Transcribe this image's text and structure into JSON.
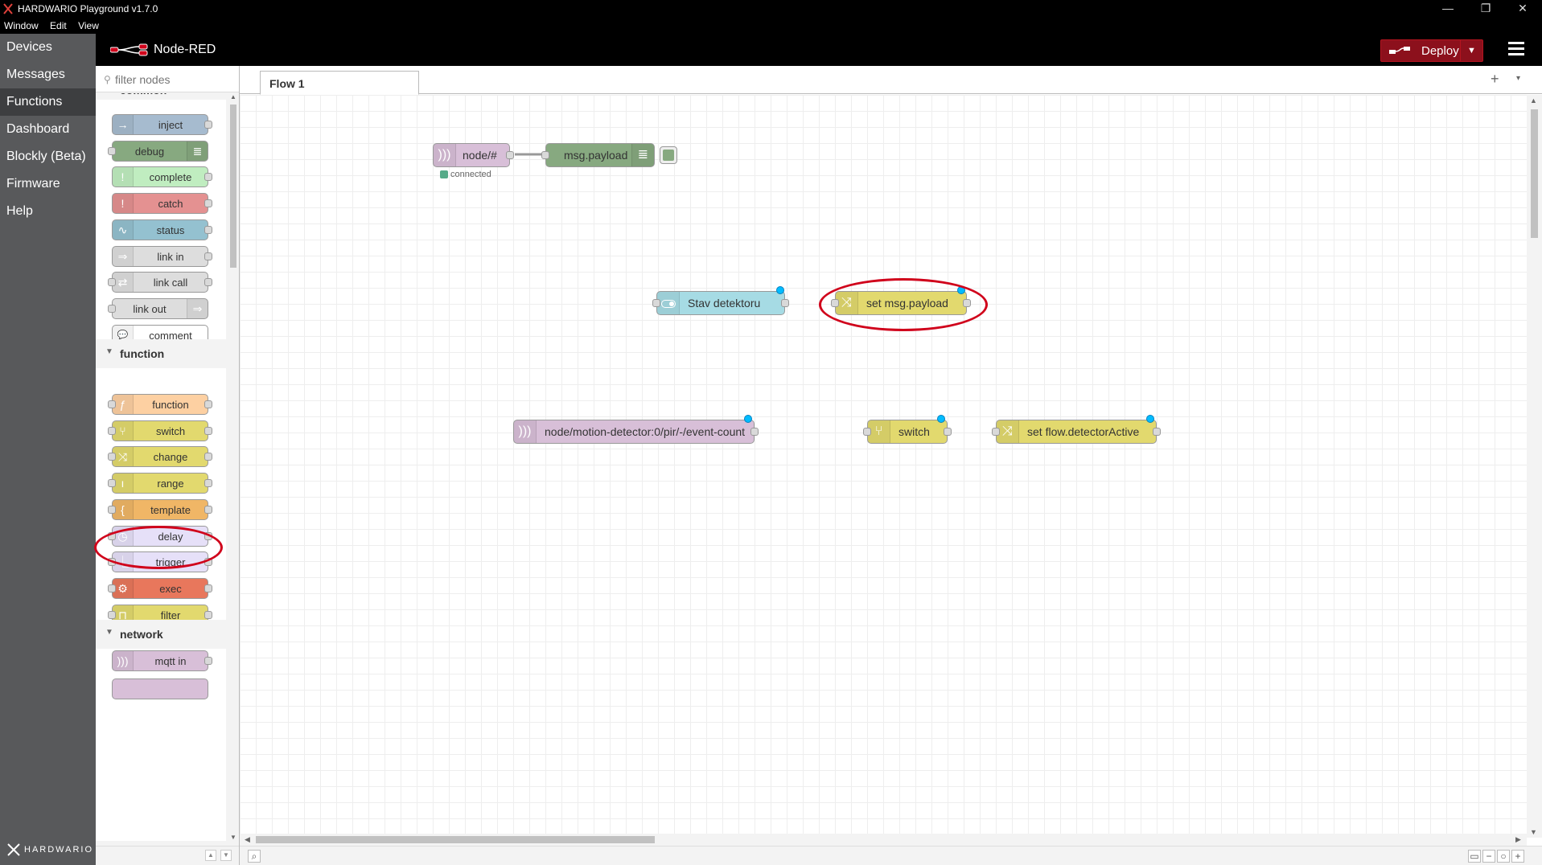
{
  "window": {
    "title": "HARDWARIO Playground v1.7.0",
    "menu": [
      "Window",
      "Edit",
      "View"
    ],
    "controls": {
      "minimize": "—",
      "maximize": "❐",
      "close": "✕"
    }
  },
  "app_nav": {
    "items": [
      {
        "label": "Devices"
      },
      {
        "label": "Messages"
      },
      {
        "label": "Functions",
        "active": true
      },
      {
        "label": "Dashboard"
      },
      {
        "label": "Blockly (Beta)"
      },
      {
        "label": "Firmware"
      },
      {
        "label": "Help"
      }
    ],
    "brand": "HARDWARIO"
  },
  "header": {
    "logo_text": "Node-RED",
    "deploy_label": "Deploy",
    "deploy_color": "#8c101c"
  },
  "palette": {
    "search_placeholder": "filter nodes",
    "categories": {
      "common": {
        "label": "common",
        "nodes": [
          {
            "label": "inject",
            "color": "#a6bbcf",
            "icon": "→"
          },
          {
            "label": "debug",
            "color": "#87a980",
            "icon": "≣"
          },
          {
            "label": "complete",
            "color": "#c0edc0",
            "icon": "!"
          },
          {
            "label": "catch",
            "color": "#e49191",
            "icon": "!"
          },
          {
            "label": "status",
            "color": "#94c1d0",
            "icon": "∿"
          },
          {
            "label": "link in",
            "color": "#dddddd",
            "icon": "⇒"
          },
          {
            "label": "link call",
            "color": "#dddddd",
            "icon": "⇄"
          },
          {
            "label": "link out",
            "color": "#dddddd",
            "icon": "⇒"
          },
          {
            "label": "comment",
            "color": "#ffffff",
            "icon": "💬"
          }
        ]
      },
      "function": {
        "label": "function",
        "nodes": [
          {
            "label": "function",
            "color": "#fdd0a2",
            "icon": "ƒ"
          },
          {
            "label": "switch",
            "color": "#e2d96e",
            "icon": "⑂"
          },
          {
            "label": "change",
            "color": "#e2d96e",
            "icon": "⤨"
          },
          {
            "label": "range",
            "color": "#e2d96e",
            "icon": "ı"
          },
          {
            "label": "template",
            "color": "#f0b666",
            "icon": "{"
          },
          {
            "label": "delay",
            "color": "#e6e0f8",
            "icon": "◷"
          },
          {
            "label": "trigger",
            "color": "#e6e0f8",
            "icon": "⎿"
          },
          {
            "label": "exec",
            "color": "#e8775c",
            "icon": "⚙"
          },
          {
            "label": "filter",
            "color": "#e2d96e",
            "icon": "⊓"
          }
        ]
      },
      "network": {
        "label": "network",
        "nodes": [
          {
            "label": "mqtt in",
            "color": "#d8bfd8",
            "icon": ")))"
          }
        ]
      }
    }
  },
  "workspace": {
    "tabs": [
      {
        "label": "Flow 1"
      }
    ],
    "add_tab": "+",
    "tab_menu": "▾",
    "nodes": {
      "mqtt_in_node": {
        "label": "node/#",
        "status": "connected",
        "color": "#d8bfd8"
      },
      "debug_node": {
        "label": "msg.payload",
        "color": "#87a980"
      },
      "ui_switch_node": {
        "label": "Stav detektoru",
        "color": "#a6dbe4"
      },
      "change_node_1": {
        "label": "set msg.payload",
        "color": "#e2d96e"
      },
      "mqtt_in_node_2": {
        "label": "node/motion-detector:0/pir/-/event-count",
        "color": "#d8bfd8"
      },
      "switch_node": {
        "label": "switch",
        "color": "#e2d96e"
      },
      "change_node_2": {
        "label": "set flow.detectorActive",
        "color": "#e2d96e"
      }
    },
    "highlight_color": "#d0021b",
    "changed_color": "#00bcff"
  }
}
